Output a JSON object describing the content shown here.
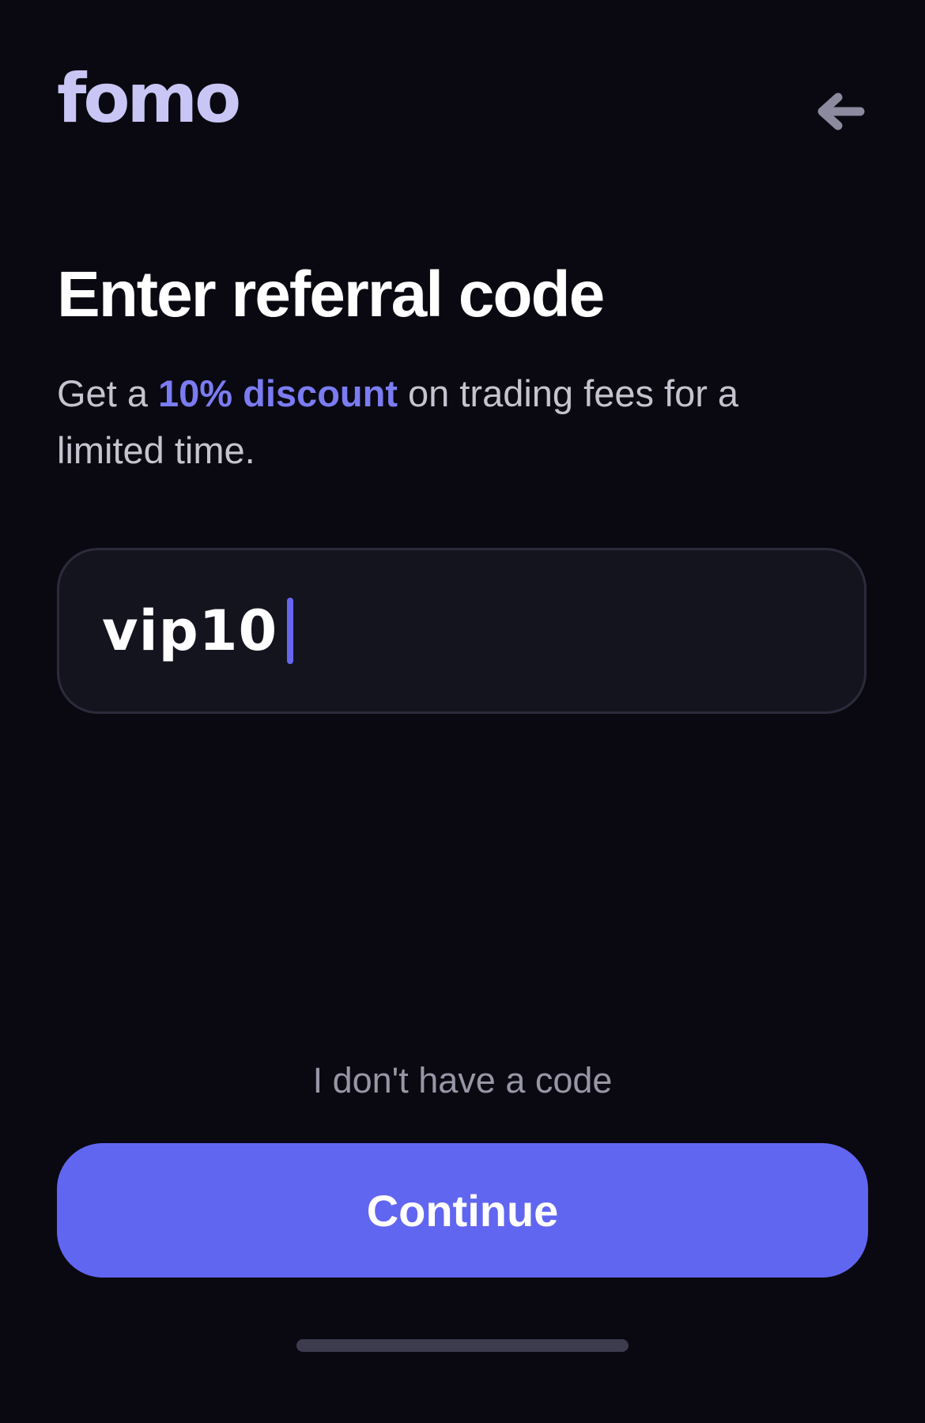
{
  "header": {
    "logo_text": "fomo",
    "back_icon": "arrow-left-icon"
  },
  "main": {
    "title": "Enter referral code",
    "subtitle": {
      "prefix": "Get a ",
      "highlight": "10% discount",
      "suffix": " on trading fees for a limited time."
    },
    "code_input": {
      "value": "vip10",
      "focused": true
    }
  },
  "footer": {
    "no_code_link": "I don't have a code",
    "continue_label": "Continue"
  },
  "colors": {
    "background": "#0a0911",
    "accent": "#6166f1",
    "highlight": "#7b7cf2",
    "logo": "#c9c6f5",
    "input_background": "#14141f"
  }
}
